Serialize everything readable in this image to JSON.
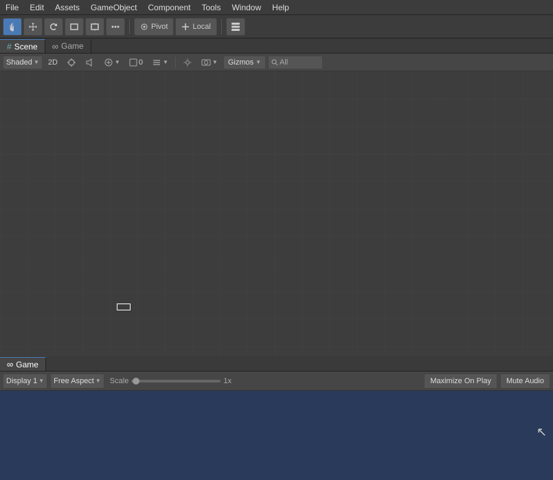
{
  "menubar": {
    "items": [
      "File",
      "Edit",
      "Assets",
      "GameObject",
      "Component",
      "Tools",
      "Window",
      "Help"
    ]
  },
  "toolbar": {
    "tools": [
      "hand",
      "move",
      "rotate",
      "rect",
      "transform",
      "dots"
    ],
    "pivot_label": "Pivot",
    "local_label": "Local",
    "layers_icon": "⊞"
  },
  "scene_tab": {
    "label": "Scene",
    "hash": "#"
  },
  "game_tab": {
    "label": "Game",
    "infinity": "∞"
  },
  "scene_toolbar": {
    "shading_mode": "Shaded",
    "button_2d": "2D",
    "overlay_count": "0",
    "gizmos_label": "Gizmos",
    "search_placeholder": "All"
  },
  "game_toolbar": {
    "display_label": "Display 1",
    "aspect_label": "Free Aspect",
    "scale_label": "Scale",
    "scale_value": "1x",
    "maximize_label": "Maximize On Play",
    "mute_label": "Mute Audio"
  },
  "scene_object": {
    "type": "rectangle"
  },
  "cursor": {
    "symbol": "↖"
  }
}
